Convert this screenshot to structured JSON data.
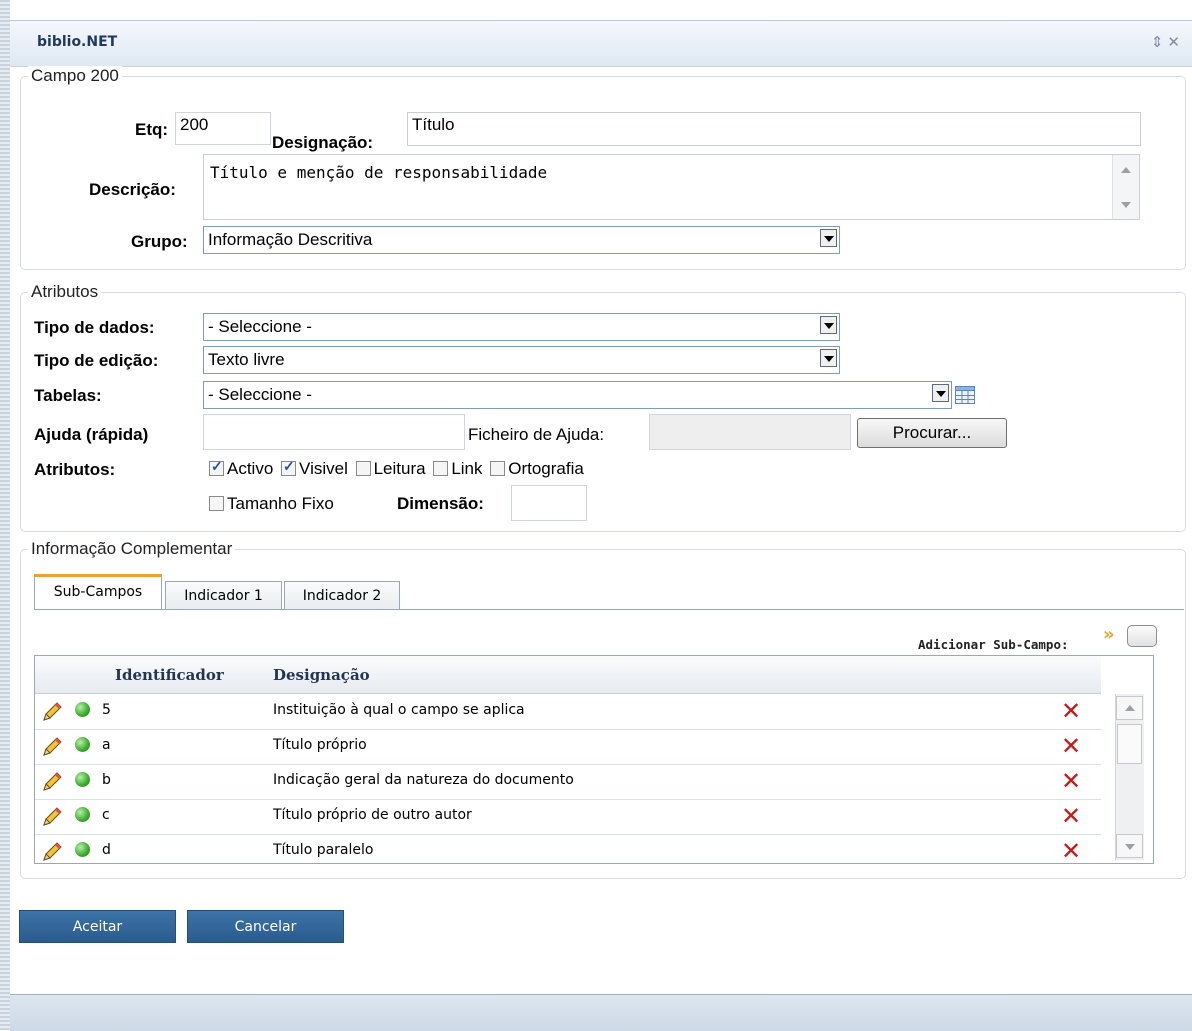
{
  "window": {
    "title": "biblio.NET",
    "tools": "⇕ X"
  },
  "campo": {
    "legend": "Campo 200",
    "etq_label": "Etq:",
    "etq_value": "200",
    "designacao_label": "Designação:",
    "designacao_value": "Título",
    "descricao_label": "Descrição:",
    "descricao_value": "Título e menção de responsabilidade",
    "grupo_label": "Grupo:",
    "grupo_value": "Informação Descritiva"
  },
  "atributos": {
    "legend": "Atributos",
    "tipo_dados_label": "Tipo de dados:",
    "tipo_dados_value": "- Seleccione -",
    "tipo_edicao_label": "Tipo de edição:",
    "tipo_edicao_value": "Texto livre",
    "tabelas_label": "Tabelas:",
    "tabelas_value": "- Seleccione -",
    "ajuda_label": "Ajuda (rápida)",
    "ajuda_value": "",
    "ficheiro_label": "Ficheiro de Ajuda:",
    "ficheiro_value": "",
    "procurar_label": "Procurar...",
    "atributos_label": "Atributos:",
    "checkboxes": [
      {
        "label": "Activo",
        "checked": true
      },
      {
        "label": "Visivel",
        "checked": true
      },
      {
        "label": "Leitura",
        "checked": false
      },
      {
        "label": "Link",
        "checked": false
      },
      {
        "label": "Ortografia",
        "checked": false
      }
    ],
    "tamanho_fixo_label": "Tamanho Fixo",
    "tamanho_fixo_checked": false,
    "dimensao_label": "Dimensão:",
    "dimensao_value": ""
  },
  "complementar": {
    "legend": "Informação Complementar",
    "tabs": [
      {
        "label": "Sub-Campos",
        "active": true
      },
      {
        "label": "Indicador 1",
        "active": false
      },
      {
        "label": "Indicador 2",
        "active": false
      }
    ],
    "add_label": "Adicionar Sub-Campo:",
    "grid": {
      "columns": [
        "Identificador",
        "Designação"
      ],
      "rows": [
        {
          "id": "5",
          "designacao": "Instituição à qual o campo se aplica"
        },
        {
          "id": "a",
          "designacao": "Título próprio"
        },
        {
          "id": "b",
          "designacao": "Indicação geral da natureza do documento"
        },
        {
          "id": "c",
          "designacao": "Título próprio de outro autor"
        },
        {
          "id": "d",
          "designacao": "Título paralelo"
        }
      ]
    }
  },
  "actions": {
    "accept_label": "Aceitar",
    "cancel_label": "Cancelar"
  },
  "colors": {
    "accent": "#2a5b8d",
    "delete": "#c81818",
    "status_ok": "#39a92b",
    "tab_highlight": "#f0a030"
  }
}
